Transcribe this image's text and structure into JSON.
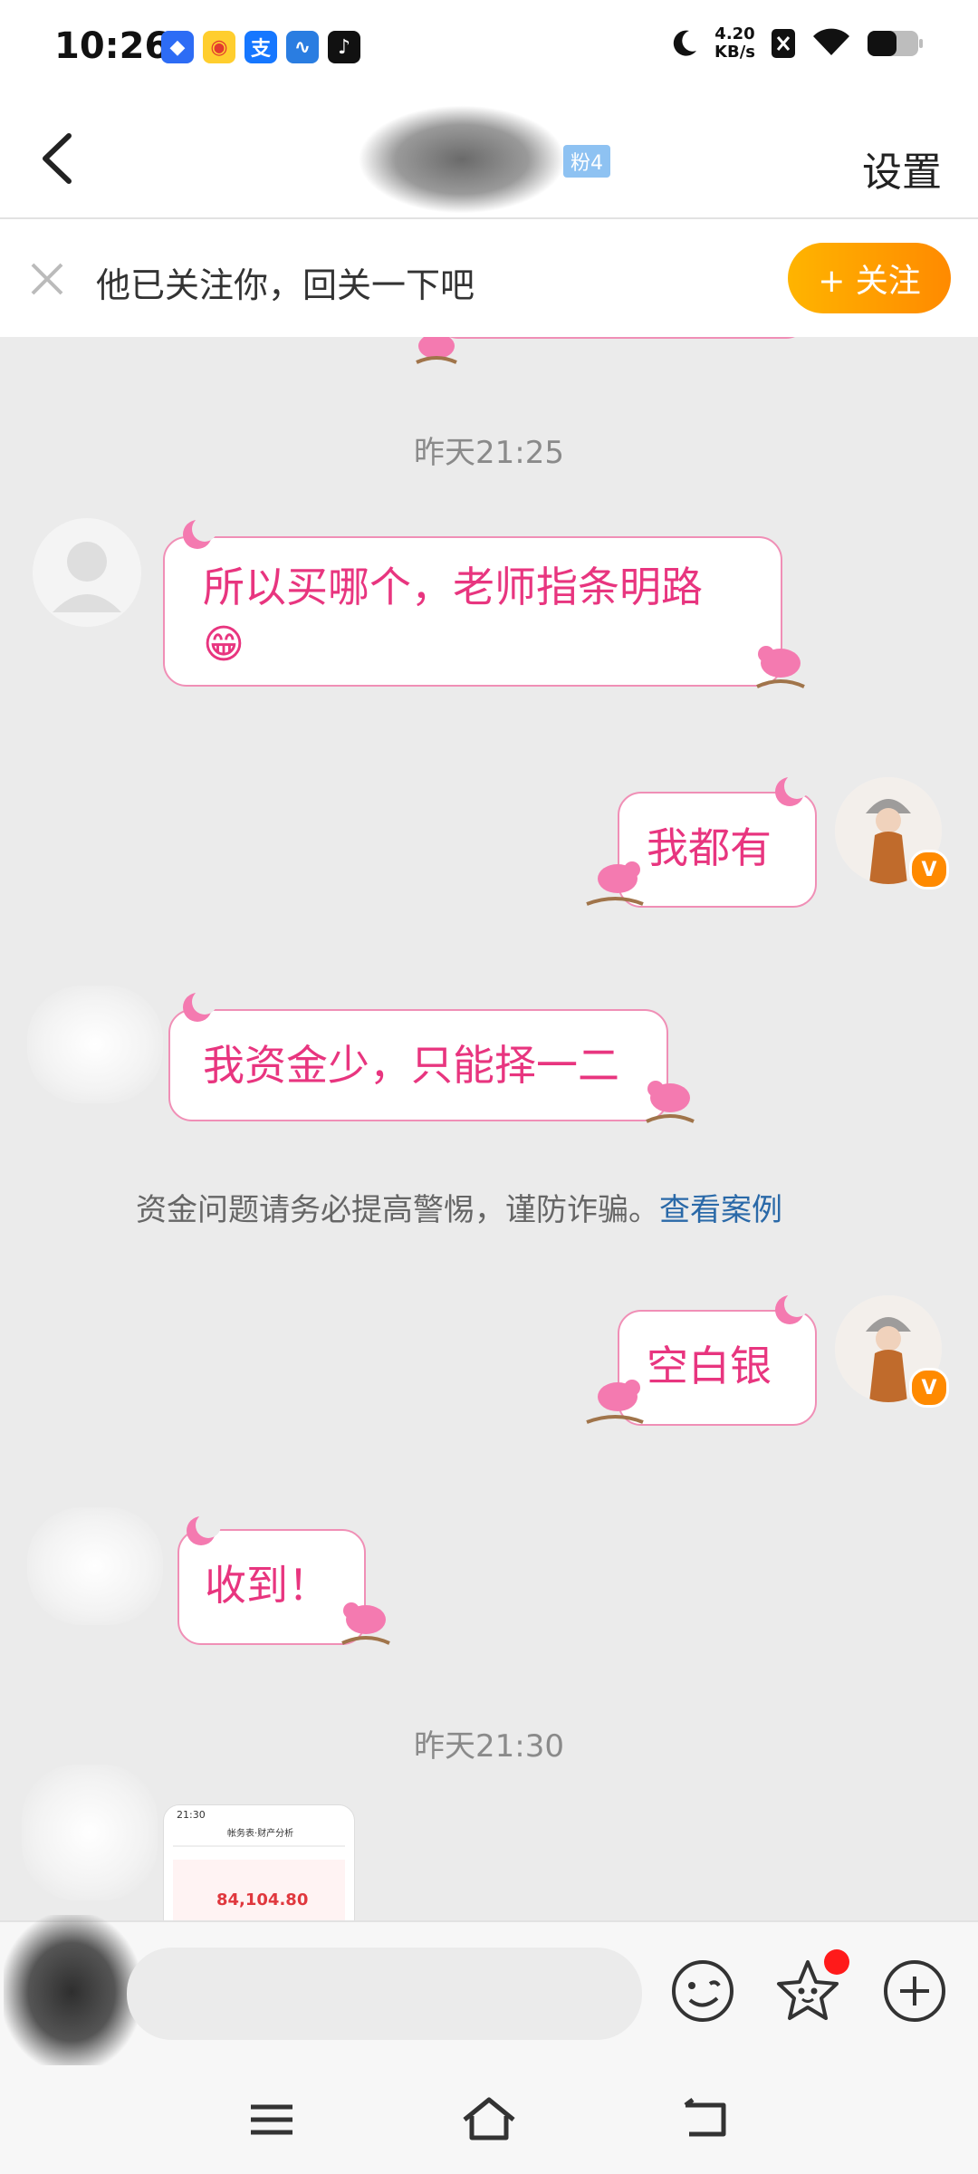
{
  "status_bar": {
    "time": "10:26",
    "net_speed_value": "4.20",
    "net_speed_unit": "KB/s",
    "app_icons": [
      "qq-icon",
      "weibo-icon",
      "alipay-icon",
      "stocks-icon",
      "tiktok-icon"
    ]
  },
  "header": {
    "back_icon": "chevron-left-icon",
    "fan_badge": "粉4",
    "settings_label": "设置"
  },
  "follow_banner": {
    "text": "他已关注你，回关一下吧",
    "button_label": "+ 关注"
  },
  "chat": {
    "timestamps": [
      "昨天21:25",
      "昨天21:30"
    ],
    "messages": [
      {
        "side": "left",
        "text": "所以买哪个，老师指条明路",
        "emoji": "😁"
      },
      {
        "side": "right",
        "text": "我都有"
      },
      {
        "side": "left",
        "text": "我资金少，只能择一二"
      },
      {
        "side": "right",
        "text": "空白银"
      },
      {
        "side": "left",
        "text": "收到！"
      }
    ],
    "safety_notice": {
      "prefix": "资金问题请务必提高警惕，谨防诈骗。",
      "link": "查看案例"
    },
    "image_preview": {
      "time": "21:30",
      "title": "帐务表·财产分析",
      "value": "84,104.80"
    }
  },
  "input_bar": {
    "icons": [
      "emoji-icon",
      "sticker-icon",
      "add-icon"
    ]
  },
  "nav_bar": {
    "icons": [
      "menu-icon",
      "home-icon",
      "back-icon"
    ]
  },
  "colors": {
    "bubble_text": "#e8357f",
    "bubble_border": "#f08fb6",
    "follow_button": "#ff9a00",
    "link": "#2a69a8",
    "background": "#ebebeb"
  }
}
